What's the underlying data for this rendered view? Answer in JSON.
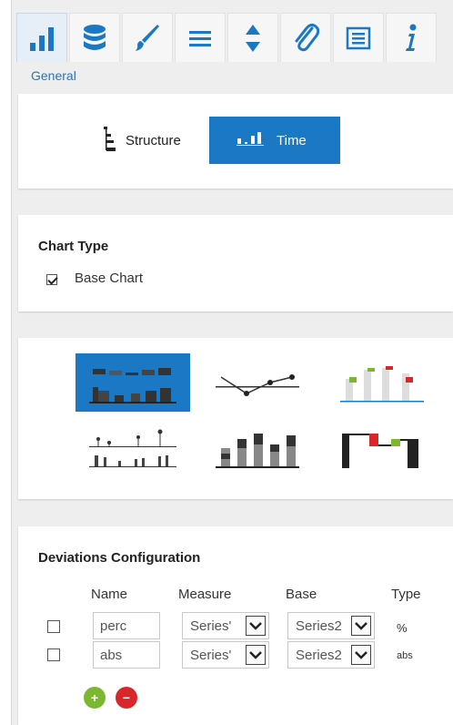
{
  "toolbar": {
    "tabs": [
      {
        "icon": "bar-chart-icon"
      },
      {
        "icon": "database-icon"
      },
      {
        "icon": "brush-icon"
      },
      {
        "icon": "menu-icon"
      },
      {
        "icon": "sort-icon"
      },
      {
        "icon": "paperclip-icon"
      },
      {
        "icon": "list-icon"
      },
      {
        "icon": "info-icon"
      }
    ],
    "active_color": "#1b78c4"
  },
  "section": {
    "label": "General"
  },
  "mode": {
    "structure_label": "Structure",
    "time_label": "Time",
    "selected": "Time"
  },
  "chart_type": {
    "title": "Chart Type",
    "base_chart_label": "Base Chart",
    "base_chart_checked": true
  },
  "chart_variants": {
    "selected_index": 0
  },
  "deviations": {
    "title": "Deviations Configuration",
    "headers": {
      "name": "Name",
      "measure": "Measure",
      "base": "Base",
      "type": "Type"
    },
    "rows": [
      {
        "name": "perc",
        "measure": "Series'",
        "base": "Series2",
        "type": "%"
      },
      {
        "name": "abs",
        "measure": "Series'",
        "base": "Series2",
        "type": "abs"
      }
    ]
  },
  "colors": {
    "accent": "#1b78c4",
    "add": "#7cb82f",
    "remove": "#d9262a",
    "label_blue": "#2a74b6"
  }
}
